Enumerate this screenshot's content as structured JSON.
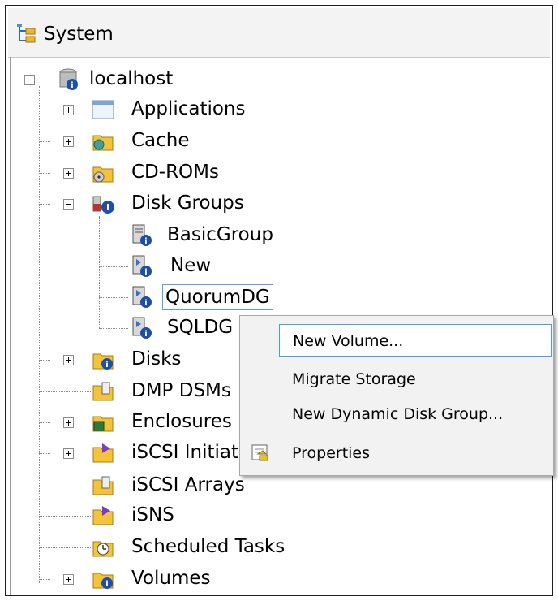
{
  "header": {
    "title": "System",
    "icon": "system-tree-icon"
  },
  "tree": {
    "root": {
      "label": "localhost",
      "icon": "server-info-icon"
    },
    "items": [
      {
        "label": "Applications",
        "icon": "window-icon"
      },
      {
        "label": "Cache",
        "icon": "cache-folder-icon"
      },
      {
        "label": "CD-ROMs",
        "icon": "cdrom-folder-icon"
      },
      {
        "label": "Disk Groups",
        "icon": "disk-groups-icon"
      },
      {
        "label": "BasicGroup",
        "icon": "disk-group-icon"
      },
      {
        "label": "New",
        "icon": "dynamic-disk-group-icon"
      },
      {
        "label": "QuorumDG",
        "icon": "dynamic-disk-group-icon"
      },
      {
        "label": "SQLDG",
        "icon": "dynamic-disk-group-icon"
      },
      {
        "label": "Disks",
        "icon": "disks-folder-icon"
      },
      {
        "label": "DMP DSMs",
        "icon": "dmp-folder-icon"
      },
      {
        "label": "Enclosures",
        "icon": "enclosure-folder-icon"
      },
      {
        "label": "iSCSI Initiators",
        "icon": "iscsi-initiator-icon"
      },
      {
        "label": "iSCSI Arrays",
        "icon": "iscsi-array-icon"
      },
      {
        "label": "iSNS",
        "icon": "isns-icon"
      },
      {
        "label": "Scheduled Tasks",
        "icon": "scheduled-tasks-icon"
      },
      {
        "label": "Volumes",
        "icon": "volumes-folder-icon"
      }
    ]
  },
  "context_menu": {
    "items": [
      "New Volume...",
      "Migrate Storage",
      "New Dynamic Disk Group...",
      "Properties"
    ],
    "properties_icon": "properties-icon"
  }
}
